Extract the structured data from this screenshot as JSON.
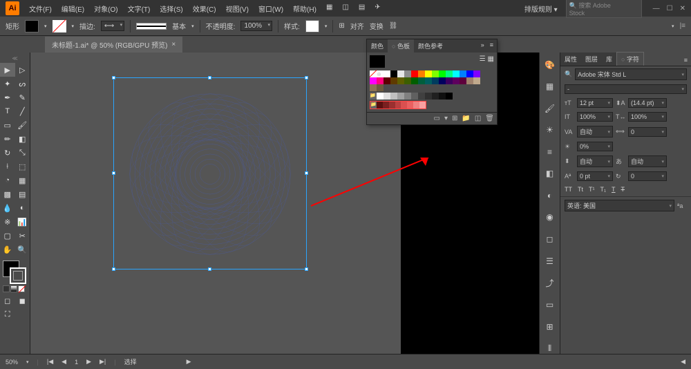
{
  "menu": {
    "items": [
      "文件(F)",
      "编辑(E)",
      "对象(O)",
      "文字(T)",
      "选择(S)",
      "效果(C)",
      "视图(V)",
      "窗口(W)",
      "帮助(H)"
    ]
  },
  "workspace_label": "排版规则",
  "search_placeholder": "搜索 Adobe Stock",
  "optbar": {
    "label": "矩形",
    "stroke": "描边:",
    "basic": "基本",
    "opacity_label": "不透明度:",
    "opacity_val": "100%",
    "style": "样式:",
    "align": "对齐",
    "transform": "变换"
  },
  "doc": {
    "title": "未标题-1.ai* @ 50% (RGB/GPU 预览)"
  },
  "swatches": {
    "tabs": [
      "颜色",
      "色板",
      "颜色参考"
    ],
    "colors_grid": [
      "#ffffff",
      "#000000",
      "#e6e6e6",
      "#8c8c8c",
      "#ff0000",
      "#ff7f00",
      "#ffff00",
      "#7fff00",
      "#00ff00",
      "#00ff7f",
      "#00ffff",
      "#007fff",
      "#0000ff",
      "#7f00ff",
      "#ff00ff",
      "#ff007f"
    ],
    "muted": [
      "#5a0000",
      "#5e3a00",
      "#5e5e00",
      "#3c5e00",
      "#005e00",
      "#005e3c",
      "#005e5e",
      "#003c5e",
      "#00005e",
      "#3c005e",
      "#5e005e",
      "#5e003c",
      "#a0826d",
      "#c0a98c",
      "#8b7355",
      "#6b5a3f"
    ],
    "grays": [
      "#ffffff",
      "#e0e0e0",
      "#c0c0c0",
      "#a0a0a0",
      "#808080",
      "#606060",
      "#404040",
      "#303030",
      "#202020",
      "#101010",
      "#000000"
    ],
    "reds": [
      "#5a1010",
      "#7a2020",
      "#9a3030",
      "#ba4040",
      "#da5050",
      "#ea6060",
      "#f08080",
      "#f8a0a0"
    ]
  },
  "char": {
    "tabs": [
      "属性",
      "图层",
      "库",
      "字符"
    ],
    "font": "Adobe 宋体 Std L",
    "size": "12 pt",
    "leading": "(14.4 pt)",
    "kerning": "100%",
    "tracking": "0",
    "vscale": "自动",
    "hscale": "自动",
    "baseline": "0 pt",
    "rotation": "自动",
    "opacity": "0%",
    "caps": [
      "TT",
      "Tt",
      "tt"
    ],
    "lang_label": "英语: 美国"
  },
  "status": {
    "zoom": "50%",
    "page": "1",
    "tool": "选择"
  }
}
